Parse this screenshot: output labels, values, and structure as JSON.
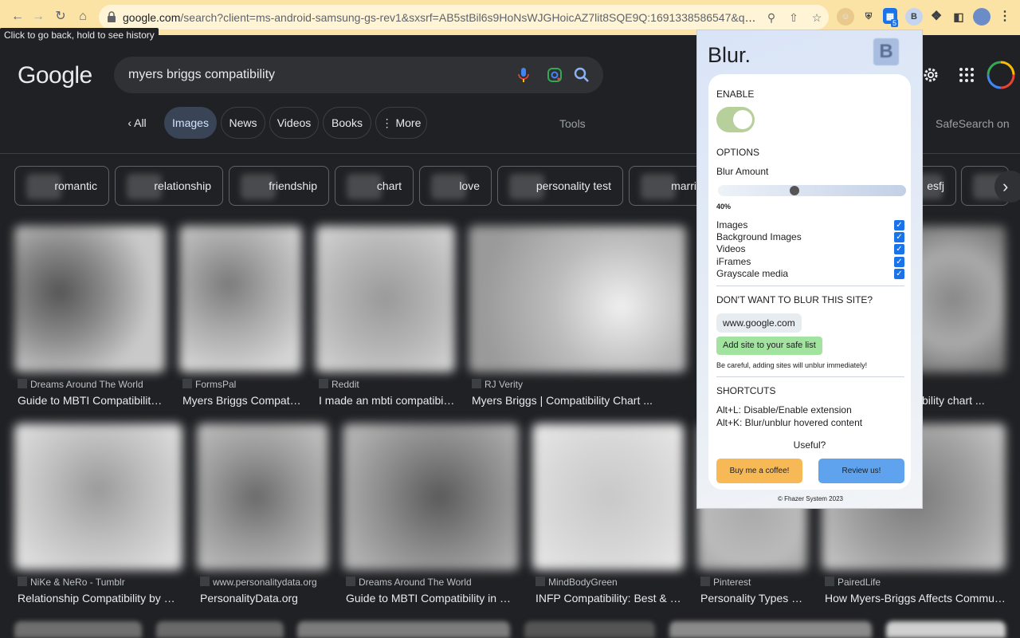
{
  "browser": {
    "url_host": "google.com",
    "url_rest": "/search?client=ms-android-samsung-gs-rev1&sxsrf=AB5stBil6s9HoNsWJGHoicAZ7lit8SQE9Q:1691338586547&q=myers...",
    "tooltip": "Click to go back, hold to see history",
    "ext_badge": "5",
    "ext_letter": "B"
  },
  "google": {
    "logo": "Google",
    "query": "myers briggs compatibility",
    "tabs": [
      "All",
      "Images",
      "News",
      "Videos",
      "Books",
      "More"
    ],
    "tools": "Tools",
    "safesearch": "SafeSearch on",
    "chips": [
      "romantic",
      "relationship",
      "friendship",
      "chart",
      "love",
      "personality test",
      "marri",
      "esfj"
    ],
    "row1": [
      {
        "source": "Dreams Around The World",
        "title": "Guide to MBTI Compatibility in..."
      },
      {
        "source": "FormsPal",
        "title": "Myers Briggs Compatibi..."
      },
      {
        "source": "Reddit",
        "title": "I made an mbti compatibilit..."
      },
      {
        "source": "RJ Verity",
        "title": "Myers Briggs | Compatibility Chart ..."
      },
      {
        "source": "",
        "title": "tibility chart ..."
      }
    ],
    "row2": [
      {
        "source": "NiKe & NeRo - Tumblr",
        "title": "Relationship Compatibility by MBT..."
      },
      {
        "source": "www.personalitydata.org",
        "title": "PersonalityData.org"
      },
      {
        "source": "Dreams Around The World",
        "title": "Guide to MBTI Compatibility in Dati..."
      },
      {
        "source": "MindBodyGreen",
        "title": "INFP Compatibility: Best & Wo..."
      },
      {
        "source": "Pinterest",
        "title": "Personality Types & ..."
      },
      {
        "source": "PairedLife",
        "title": "How Myers-Briggs Affects Communic..."
      }
    ]
  },
  "popup": {
    "title": "Blur.",
    "logo_letter": "B",
    "enable_label": "ENABLE",
    "enabled": true,
    "options_label": "OPTIONS",
    "blur_amount_label": "Blur Amount",
    "blur_amount_value": "40%",
    "blur_amount_fraction": 0.4,
    "options": [
      {
        "label": "Images",
        "checked": true
      },
      {
        "label": "Background Images",
        "checked": true
      },
      {
        "label": "Videos",
        "checked": true
      },
      {
        "label": "iFrames",
        "checked": true
      },
      {
        "label": "Grayscale media",
        "checked": true
      }
    ],
    "dont_blur_label": "DON'T WANT TO BLUR THIS SITE?",
    "site": "www.google.com",
    "add_button": "Add site to your safe list",
    "warning": "Be careful, adding sites will unblur immediately!",
    "shortcuts_label": "SHORTCUTS",
    "shortcut1": "Alt+L: Disable/Enable extension",
    "shortcut2": "Alt+K: Blur/unblur hovered content",
    "useful": "Useful?",
    "coffee_button": "Buy me a coffee!",
    "review_button": "Review us!",
    "copyright": "© Fhazer System 2023"
  }
}
